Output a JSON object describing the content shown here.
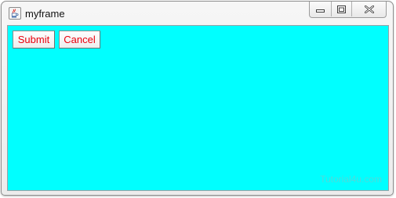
{
  "window": {
    "title": "myframe",
    "icon": "java-coffee-cup-icon",
    "controls": {
      "minimize_icon": "minimize-icon",
      "maximize_icon": "restore-icon",
      "close_icon": "close-icon"
    }
  },
  "content": {
    "background_color": "#00ffff",
    "buttons": [
      {
        "label": "Submit",
        "text_color": "#e8000d"
      },
      {
        "label": "Cancel",
        "text_color": "#e8000d"
      }
    ],
    "watermark": "Tutorial4u.com"
  }
}
